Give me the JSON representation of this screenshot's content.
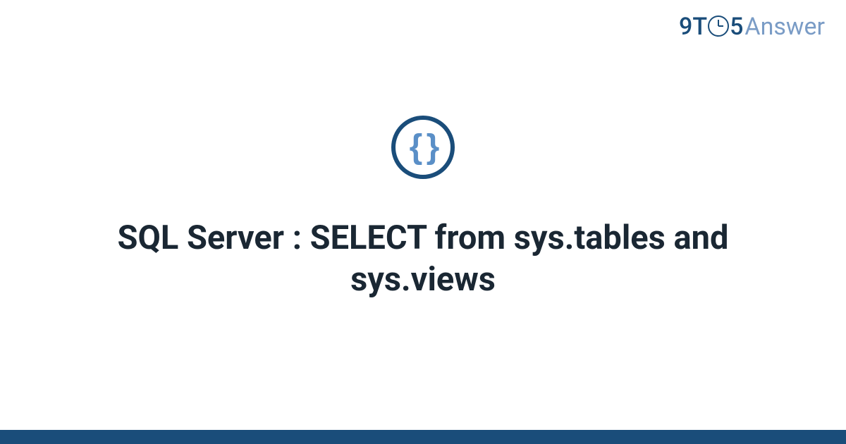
{
  "logo": {
    "prefix": "9T",
    "suffix": "5",
    "word": "Answer"
  },
  "icon": {
    "braces": "{ }",
    "name": "code-braces-icon"
  },
  "title": "SQL Server : SELECT from sys.tables and sys.views",
  "colors": {
    "primary": "#1a4d7a",
    "secondary": "#7a9cc6",
    "text": "#1a2733"
  }
}
